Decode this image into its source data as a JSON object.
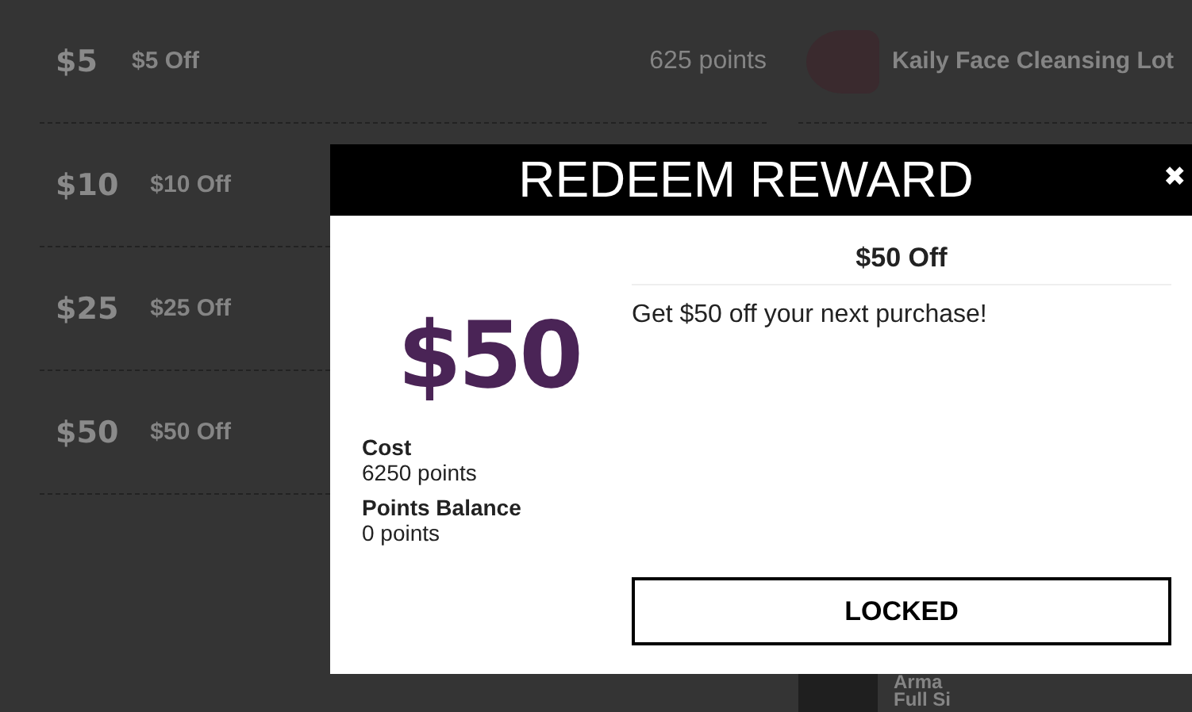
{
  "rewards": [
    {
      "amount": "$5",
      "name": "$5 Off",
      "points": "625 points"
    },
    {
      "amount": "$10",
      "name": "$10 Off"
    },
    {
      "amount": "$25",
      "name": "$25 Off"
    },
    {
      "amount": "$50",
      "name": "$50 Off"
    }
  ],
  "products": [
    {
      "name": "Kaily Face Cleansing Lot"
    },
    {
      "name": "Arma",
      "name_line_2": "Full Si"
    }
  ],
  "modal": {
    "title": "REDEEM REWARD",
    "close": "✖",
    "amount": "$50",
    "reward_title": "$50 Off",
    "description": "Get $50 off your next purchase!",
    "details": [
      {
        "label": "Cost",
        "value": "6250 points"
      },
      {
        "label": "Points Balance",
        "value": "0 points"
      }
    ],
    "button": "LOCKED"
  }
}
